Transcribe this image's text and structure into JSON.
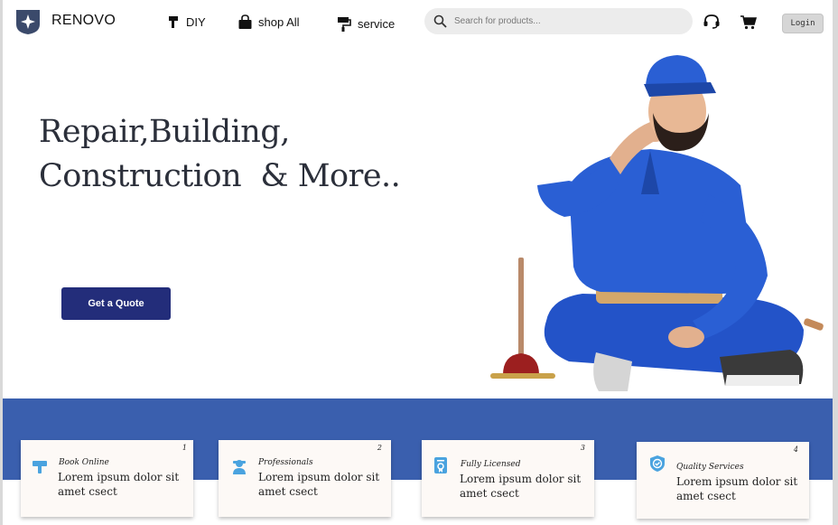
{
  "brand": {
    "name": "RENOVO"
  },
  "nav": [
    {
      "label": "DIY",
      "icon": "paint-roller-icon"
    },
    {
      "label": "shop All",
      "icon": "shopping-bag-icon"
    },
    {
      "label": "service",
      "icon": "paint-roller-service-icon"
    }
  ],
  "search": {
    "placeholder": "Search for products..."
  },
  "header_actions": {
    "support_icon": "headset-icon",
    "cart_icon": "cart-icon",
    "login_label": "Login"
  },
  "hero": {
    "title_line1": "Repair,Building,",
    "title_line2": "Construction  & More..",
    "cta_label": "Get a Quote",
    "image": "plumber-with-plunger-photo"
  },
  "features": [
    {
      "number": "1",
      "title": "Book Online",
      "text": "Lorem ipsum dolor sit amet csect",
      "icon": "wrench-icon"
    },
    {
      "number": "2",
      "title": "Professionals",
      "text": "Lorem ipsum dolor sit amet csect",
      "icon": "worker-icon"
    },
    {
      "number": "3",
      "title": "Fully Licensed",
      "text": "Lorem ipsum dolor sit amet csect",
      "icon": "certificate-icon"
    },
    {
      "number": "4",
      "title": "Quality Services",
      "text": "Lorem ipsum dolor sit amet csect",
      "icon": "shield-check-icon"
    }
  ],
  "colors": {
    "primary": "#232d7a",
    "band": "#3a5fae",
    "icon_accent": "#4aa3df"
  }
}
